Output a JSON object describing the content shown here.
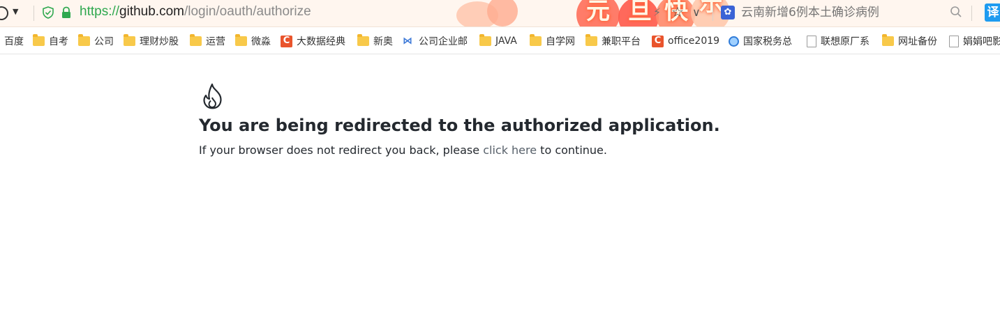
{
  "browser": {
    "url_scheme": "https://",
    "url_host": "github.com",
    "url_path": "/login/oauth/authorize",
    "festival_banner": [
      "元",
      "旦",
      "快",
      "乐"
    ],
    "search_placeholder": "云南新增6例本土确诊病例",
    "translate_label": "译",
    "paw_icon": "paw-icon"
  },
  "bookmarks": [
    {
      "label": "百度",
      "icon": "none"
    },
    {
      "label": "自考",
      "icon": "folder"
    },
    {
      "label": "公司",
      "icon": "folder"
    },
    {
      "label": "理财炒股",
      "icon": "folder"
    },
    {
      "label": "运营",
      "icon": "folder"
    },
    {
      "label": "微淼",
      "icon": "folder"
    },
    {
      "label": "大数据经典",
      "icon": "csdn-c"
    },
    {
      "label": "新奥",
      "icon": "folder"
    },
    {
      "label": "公司企业邮",
      "icon": "mail-m"
    },
    {
      "label": "JAVA",
      "icon": "folder"
    },
    {
      "label": "自学网",
      "icon": "folder"
    },
    {
      "label": "兼职平台",
      "icon": "folder"
    },
    {
      "label": "office2019",
      "icon": "csdn-c"
    },
    {
      "label": "国家税务总",
      "icon": "search-globe"
    },
    {
      "label": "联想原厂系",
      "icon": "file"
    },
    {
      "label": "网址备份",
      "icon": "folder"
    },
    {
      "label": "娟娟吧影",
      "icon": "file"
    }
  ],
  "page": {
    "heading": "You are being redirected to the authorized application.",
    "note_before": "If your browser does not redirect you back, please ",
    "link_text": "click here",
    "note_after": " to continue.",
    "icon": "flame-icon"
  },
  "colors": {
    "secure_green": "#2fa84f",
    "link": "#57606a",
    "text": "#24292f",
    "folder": "#f8c94a",
    "csdn_red": "#e9542c"
  }
}
